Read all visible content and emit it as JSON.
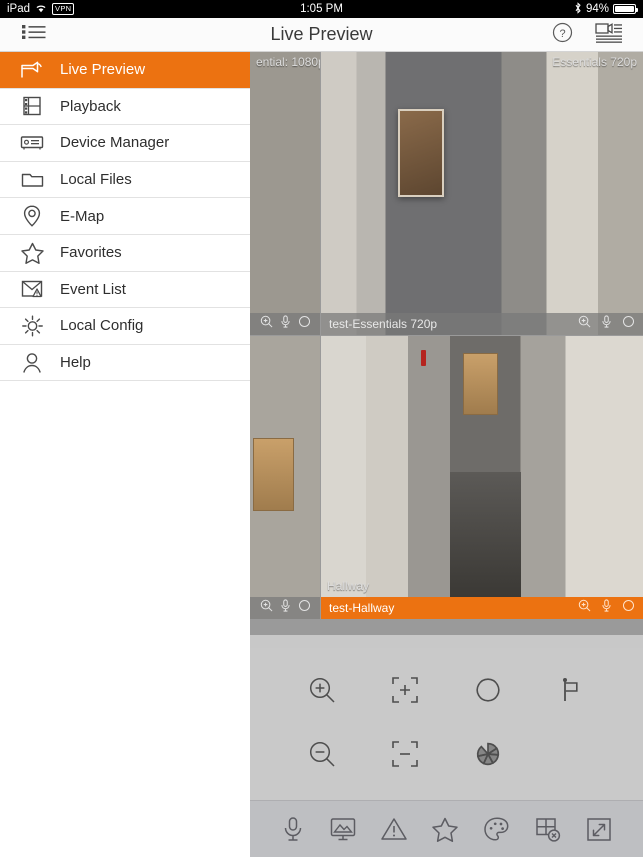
{
  "status_bar": {
    "device": "iPad",
    "wifi_icon": "wifi-icon",
    "vpn_badge": "VPN",
    "time": "1:05 PM",
    "bluetooth_icon": "bluetooth-icon",
    "battery_percent": "94%",
    "battery_level": 94
  },
  "nav_bar": {
    "menu_icon": "list-menu-icon",
    "title": "Live Preview",
    "help_icon": "help-circle-icon",
    "device_list_icon": "camera-list-icon"
  },
  "sidebar": {
    "items": [
      {
        "label": "Live Preview",
        "icon": "camera-icon",
        "active": true
      },
      {
        "label": "Playback",
        "icon": "film-strip-icon",
        "active": false
      },
      {
        "label": "Device Manager",
        "icon": "device-icon",
        "active": false
      },
      {
        "label": "Local Files",
        "icon": "folder-icon",
        "active": false
      },
      {
        "label": "E-Map",
        "icon": "map-pin-icon",
        "active": false
      },
      {
        "label": "Favorites",
        "icon": "star-icon",
        "active": false
      },
      {
        "label": "Event List",
        "icon": "envelope-alert-icon",
        "active": false
      },
      {
        "label": "Local Config",
        "icon": "gear-icon",
        "active": false
      },
      {
        "label": "Help",
        "icon": "person-icon",
        "active": false
      }
    ]
  },
  "video_grid": {
    "tiles": [
      {
        "name": "",
        "overlay_label": "ential: 1080p",
        "selected": false,
        "partial": true,
        "controls": [
          "digital-zoom-icon",
          "audio-icon",
          "record-icon"
        ]
      },
      {
        "name": "test-Essentials 720p",
        "overlay_label": "Essentials 720p",
        "selected": false,
        "partial": false,
        "controls": [
          "digital-zoom-icon",
          "audio-icon",
          "record-icon"
        ]
      },
      {
        "name": "",
        "overlay_label": "",
        "selected": false,
        "partial": true,
        "controls": [
          "digital-zoom-icon",
          "audio-icon",
          "record-icon"
        ]
      },
      {
        "name": "test-Hallway",
        "overlay_label": "Hallway",
        "selected": true,
        "partial": false,
        "controls": [
          "digital-zoom-icon",
          "audio-icon",
          "record-icon"
        ]
      }
    ]
  },
  "ptz_panel": {
    "buttons": [
      {
        "icon": "zoom-in-icon",
        "label": "Zoom In"
      },
      {
        "icon": "focus-near-icon",
        "label": "Focus +"
      },
      {
        "icon": "iris-open-icon",
        "label": "Iris +"
      },
      {
        "icon": "preset-flag-icon",
        "label": "Preset"
      },
      {
        "icon": "zoom-out-icon",
        "label": "Zoom Out"
      },
      {
        "icon": "focus-far-icon",
        "label": "Focus -"
      },
      {
        "icon": "iris-close-icon",
        "label": "Iris -"
      }
    ]
  },
  "bottom_toolbar": {
    "buttons": [
      {
        "icon": "microphone-icon",
        "label": "Two-way Audio"
      },
      {
        "icon": "snapshot-icon",
        "label": "Capture"
      },
      {
        "icon": "alarm-icon",
        "label": "Alarm"
      },
      {
        "icon": "star-icon",
        "label": "Favorite"
      },
      {
        "icon": "palette-icon",
        "label": "Image Settings"
      },
      {
        "icon": "close-window-icon",
        "label": "Stop All"
      },
      {
        "icon": "fullscreen-icon",
        "label": "Full Screen"
      }
    ]
  },
  "colors": {
    "accent": "#ec7211",
    "sidebar_bg": "#ffffff",
    "panel_bg": "#c9c9c9",
    "toolbar_bg": "#bebfc2"
  }
}
